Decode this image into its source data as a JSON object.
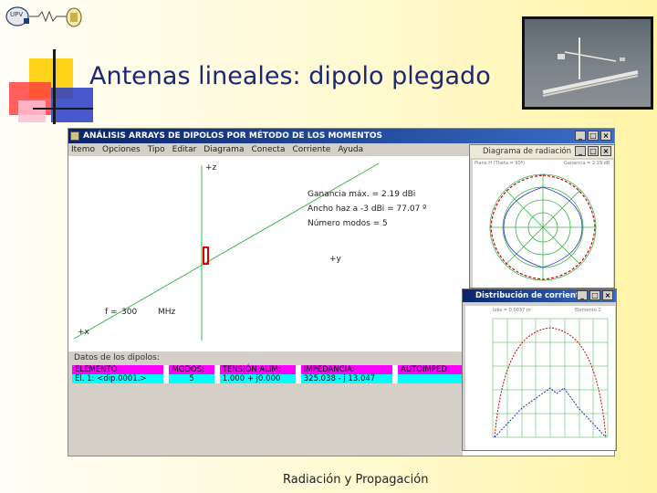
{
  "slide": {
    "title": "Antenas lineales: dipolo plegado",
    "footer": "Radiación y Propagación",
    "logo_text": "UPV"
  },
  "app": {
    "title": "ANÁLISIS ARRAYS DE DIPOLOS POR MÉTODO DE LOS MOMENTOS",
    "window_buttons": [
      "_",
      "□",
      "×"
    ],
    "menu": [
      "Itemo",
      "Opciones",
      "Tipo",
      "Editar",
      "Diagrama",
      "Conecta",
      "Corriente",
      "Ayuda"
    ],
    "axes": {
      "z": "+z",
      "y": "+y",
      "x": "+x"
    },
    "frequency": {
      "label": "f =",
      "value": "300",
      "unit": "MHz"
    },
    "stats": {
      "gain": "Ganancia máx. =      2.19    dBi",
      "beamwidth": "Ancho haz a -3  dBi = 77.07  º",
      "modes": "Número modos =    5"
    },
    "data_panel": {
      "title": "Datos de los dipolos:",
      "headers": [
        "ELEMENTO:",
        "MODOS:",
        "TENSIÓN ALIM:",
        "IMPEDANCIA:",
        "AUTOIMPED:"
      ],
      "row": [
        "El. 1: <dip.0001.>",
        "5",
        "1.000 + j0.000",
        "325.038 - j 13.047",
        ""
      ]
    }
  },
  "radiation_window": {
    "title": "Diagrama de radiación",
    "header_left": "Plano  H (Theta = 90º)",
    "header_right": "Ganancia = 2.19 dB"
  },
  "current_window": {
    "title": "Distribución de corriente:",
    "header_left": "Iobs = 0.0037 m",
    "header_right": "Elemento 1"
  },
  "colors": {
    "accent_blue": "#1d2773",
    "titlebar": "#0a246a",
    "magenta": "#ff00ff",
    "cyan": "#00ffff",
    "green_axis": "#3cb44b"
  }
}
